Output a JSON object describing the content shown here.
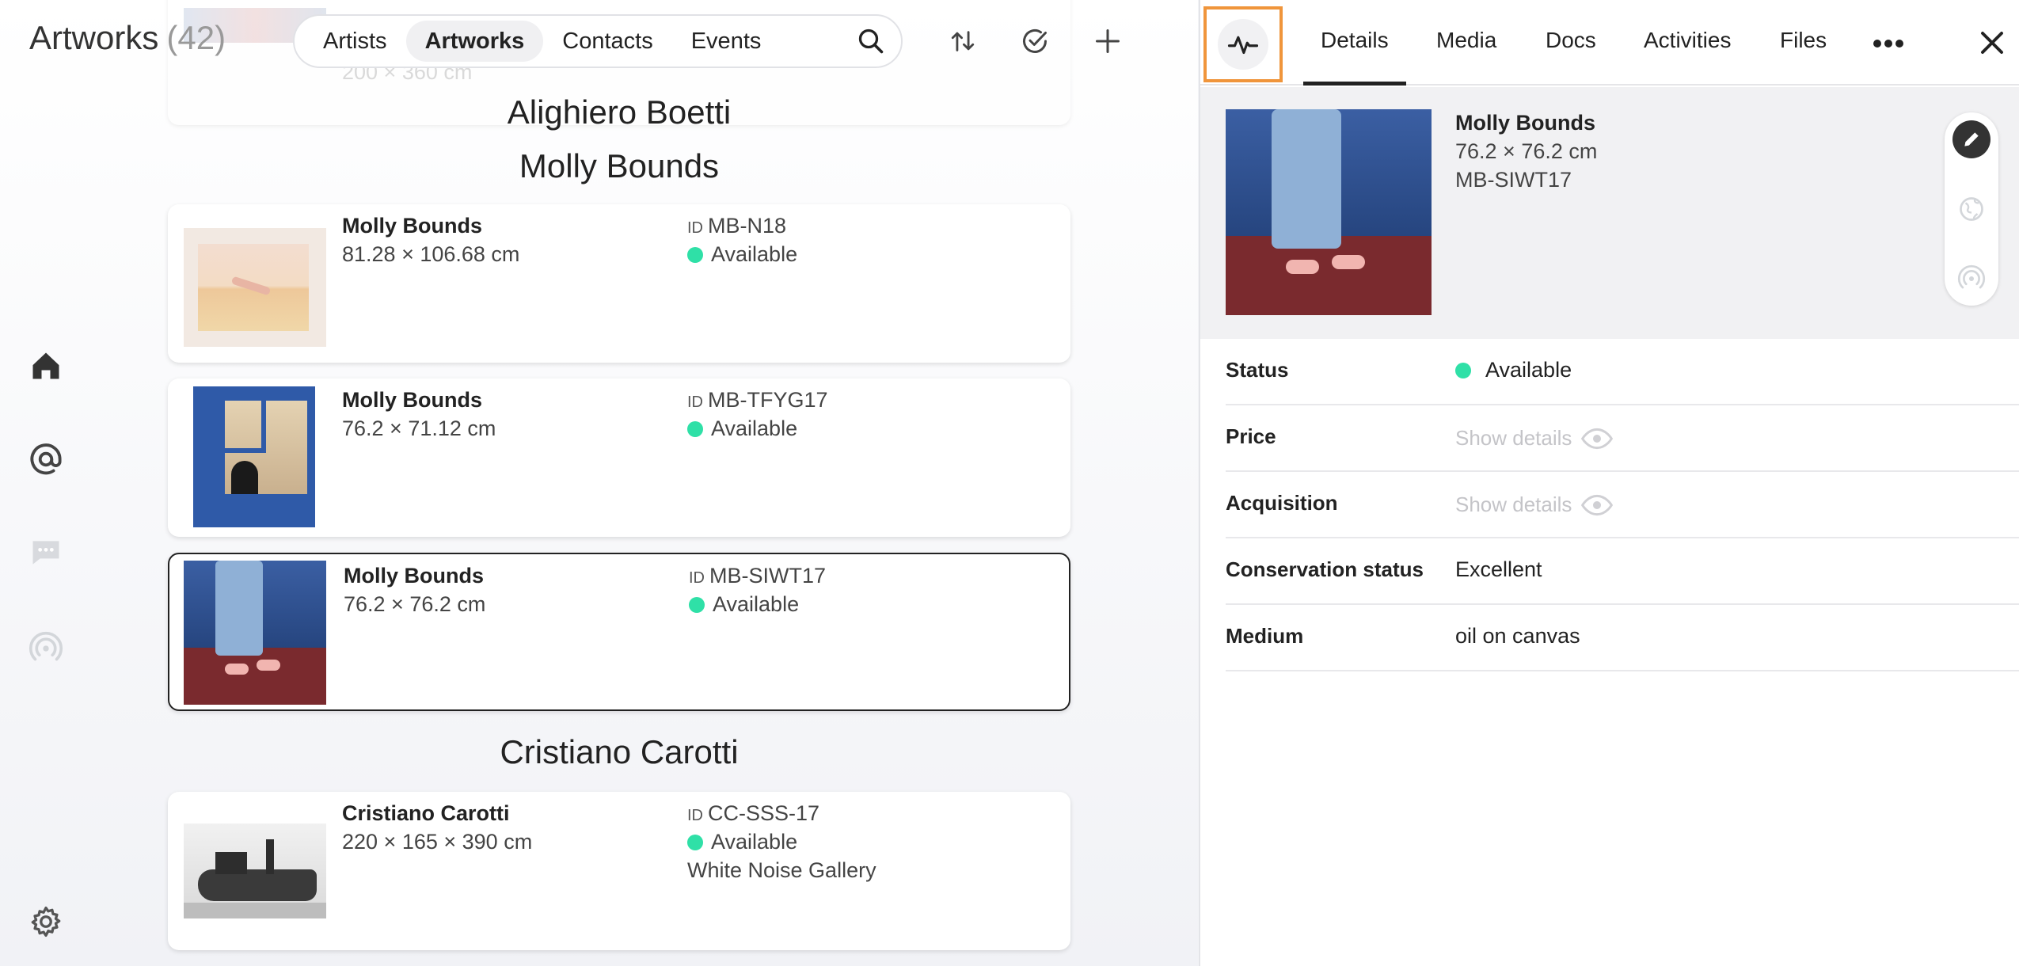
{
  "header": {
    "title": "Artworks",
    "count": "(42)",
    "nav_tabs": [
      {
        "label": "Artists"
      },
      {
        "label": "Artworks"
      },
      {
        "label": "Contacts"
      },
      {
        "label": "Events"
      }
    ],
    "tool_icons": [
      "search-icon",
      "sort-icon",
      "check-circle-icon",
      "plus-icon"
    ]
  },
  "sidebar": {
    "icons": [
      "home-icon",
      "at-icon",
      "chat-icon",
      "radar-icon",
      "settings-icon"
    ]
  },
  "list": {
    "partial_top_card": {
      "dims": "200 × 360 cm"
    },
    "groups": [
      {
        "first": "Alighiero",
        "last": "Boetti"
      },
      {
        "first": "Molly",
        "last": "Bounds"
      },
      {
        "first": "Cristiano",
        "last": "Carotti"
      }
    ],
    "id_tag": "ID",
    "cards": [
      {
        "name": "Molly Bounds",
        "dims": "81.28 × 106.68 cm",
        "id": "MB-N18",
        "status": "Available"
      },
      {
        "name": "Molly Bounds",
        "dims": "76.2 × 71.12 cm",
        "id": "MB-TFYG17",
        "status": "Available"
      },
      {
        "name": "Molly Bounds",
        "dims": "76.2 × 76.2 cm",
        "id": "MB-SIWT17",
        "status": "Available"
      },
      {
        "name": "Cristiano Carotti",
        "dims": "220 × 165 × 390 cm",
        "id": "CC-SSS-17",
        "status": "Available",
        "gallery": "White Noise Gallery"
      }
    ]
  },
  "detail": {
    "tabs": [
      {
        "label": "Details"
      },
      {
        "label": "Media"
      },
      {
        "label": "Docs"
      },
      {
        "label": "Activities"
      },
      {
        "label": "Files"
      }
    ],
    "summary": {
      "name": "Molly Bounds",
      "dims": "76.2 × 76.2 cm",
      "id": "MB-SIWT17"
    },
    "fields": [
      {
        "label": "Status",
        "value": "Available"
      },
      {
        "label": "Price",
        "value": "Show details"
      },
      {
        "label": "Acquisition",
        "value": "Show details"
      },
      {
        "label": "Conservation status",
        "value": "Excellent"
      },
      {
        "label": "Medium",
        "value": "oil on canvas"
      }
    ]
  },
  "colors": {
    "available": "#2fe0a7",
    "highlight": "#f0953b",
    "selected_border": "#222222"
  }
}
